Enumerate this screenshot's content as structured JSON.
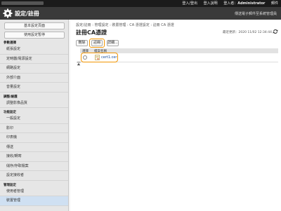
{
  "topbar": {
    "links": [
      "登入/登出",
      "登入說明",
      "登入者：",
      "Administrator",
      "郵件"
    ],
    "user_label": "登入者：",
    "user_name": "Administrator",
    "mail_label": "郵件"
  },
  "header": {
    "title": "設定/註冊",
    "right_link": "傳送電子郵件至系統管理員"
  },
  "sidebar": {
    "buttons": [
      "基本設定頁面",
      "使用設定暫停"
    ],
    "sections": [
      {
        "title": "參數選擇",
        "items": [
          "紙張設定",
          "定時器/電源設定",
          "網路設定",
          "外部介面",
          "音量設定"
        ]
      },
      {
        "title": "調整/維護",
        "items": [
          "調整影像品質"
        ]
      },
      {
        "title": "功能設定",
        "items": [
          "一般設定",
          "影印",
          "印表機",
          "傳送",
          "接收/轉寄",
          "儲存/存取檔案",
          "設定接收者"
        ]
      },
      {
        "title": "管理設定",
        "items": [
          "使用者管理",
          "裝置管理"
        ]
      }
    ]
  },
  "content": {
    "breadcrumb": "設定/註冊 : 管理設定 : 裝置管理 : CA 憑證設定 : 註冊 CA 憑證",
    "page_title": "註冊CA憑證",
    "last_updated": "最近更新：2020 11/02 12:34:44",
    "buttons": {
      "delete": "刪除",
      "register": "註冊",
      "details": "詳細..."
    },
    "table": {
      "headers": [
        "選擇",
        "檔案名稱"
      ],
      "rows": [
        {
          "file": "cert1.cer"
        }
      ]
    }
  },
  "colors": {
    "highlight": "#f29400",
    "topbar": "#1b1b1b",
    "header": "#3a3a3a",
    "link": "#1a4f9c"
  }
}
